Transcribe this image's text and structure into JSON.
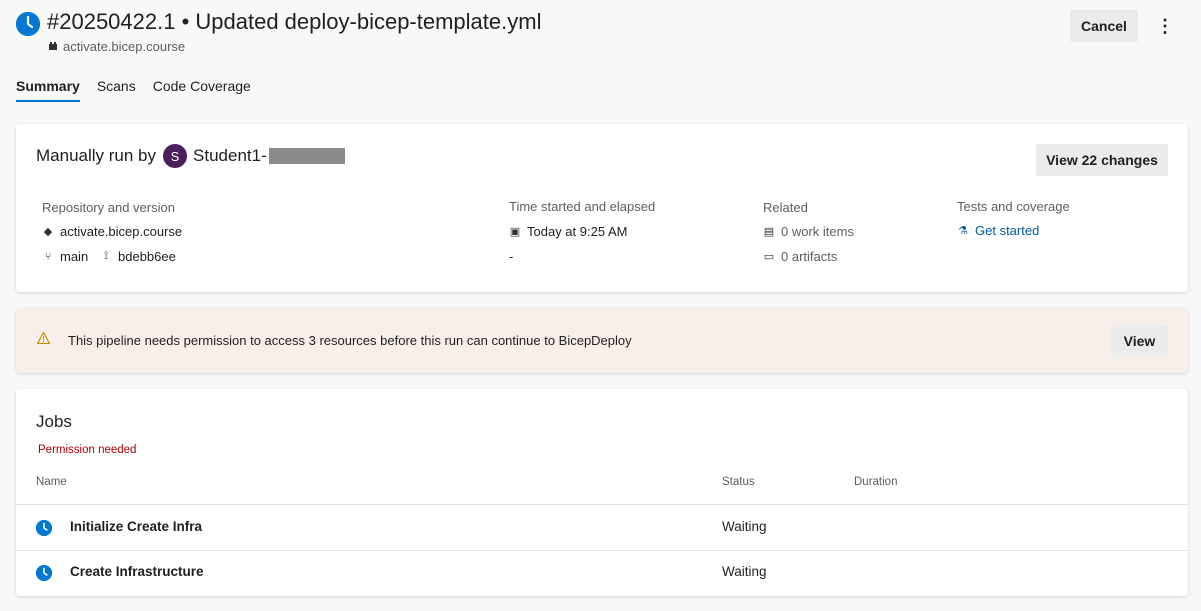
{
  "header": {
    "title": "#20250422.1 • Updated deploy-bicep-template.yml",
    "repo": "activate.bicep.course",
    "cancel_label": "Cancel",
    "more_label": "⋮"
  },
  "tabs": [
    {
      "label": "Summary",
      "active": true
    },
    {
      "label": "Scans",
      "active": false
    },
    {
      "label": "Code Coverage",
      "active": false
    }
  ],
  "summary": {
    "manual_run_prefix": "Manually run by",
    "avatar_initial": "S",
    "user_name": "Student1-",
    "view_changes_label": "View 22 changes",
    "repo_version": {
      "label": "Repository and version",
      "repo": "activate.bicep.course",
      "branch": "main",
      "commit": "bdebb6ee"
    },
    "time": {
      "label": "Time started and elapsed",
      "started": "Today at 9:25 AM",
      "elapsed": "-"
    },
    "related": {
      "label": "Related",
      "work_items": "0 work items",
      "artifacts": "0 artifacts"
    },
    "tests": {
      "label": "Tests and coverage",
      "link": "Get started"
    }
  },
  "banner": {
    "text": "This pipeline needs permission to access 3 resources before this run can continue to BicepDeploy",
    "view_label": "View"
  },
  "jobs": {
    "title": "Jobs",
    "permission": "Permission needed",
    "columns": [
      "Name",
      "Status",
      "Duration"
    ],
    "rows": [
      {
        "name": "Initialize Create Infra",
        "status": "Waiting",
        "duration": ""
      },
      {
        "name": "Create Infrastructure",
        "status": "Waiting",
        "duration": ""
      }
    ]
  },
  "colors": {
    "accent": "#0078d4",
    "warning_bg": "#f8efea",
    "error": "#a80000",
    "avatar": "#4a1f5c"
  }
}
